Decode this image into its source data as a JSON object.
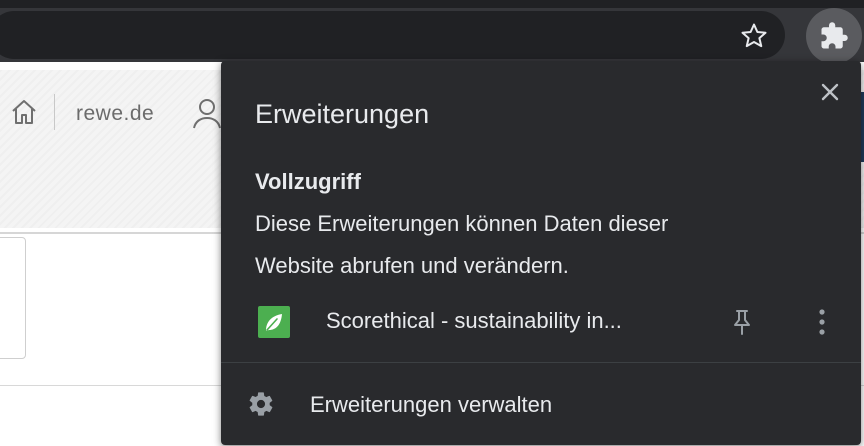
{
  "browser": {
    "icons": {
      "bookmark": "star-icon",
      "extensions": "puzzle-icon"
    },
    "colors": {
      "toolbar": "#35363a",
      "omnibox": "#202124",
      "extensions_button": "#5a5b5f"
    }
  },
  "page": {
    "domain": "rewe.de",
    "icons": {
      "home": "home-icon",
      "account": "user-icon"
    }
  },
  "popup": {
    "title": "Erweiterungen",
    "close_icon": "close-icon",
    "section": {
      "title": "Vollzugriff",
      "description_line1": "Diese Erweiterungen können Daten dieser",
      "description_line2": "Website abrufen und verändern."
    },
    "extensions": [
      {
        "name": "Scorethical - sustainability in...",
        "icon": "leaf-icon",
        "icon_color": "#4caf50",
        "pin_icon": "pin-icon",
        "menu_icon": "more-vert-icon"
      }
    ],
    "manage": {
      "label": "Erweiterungen verwalten",
      "icon": "gear-icon"
    },
    "colors": {
      "background": "#292a2d",
      "text": "#e8eaed"
    }
  }
}
